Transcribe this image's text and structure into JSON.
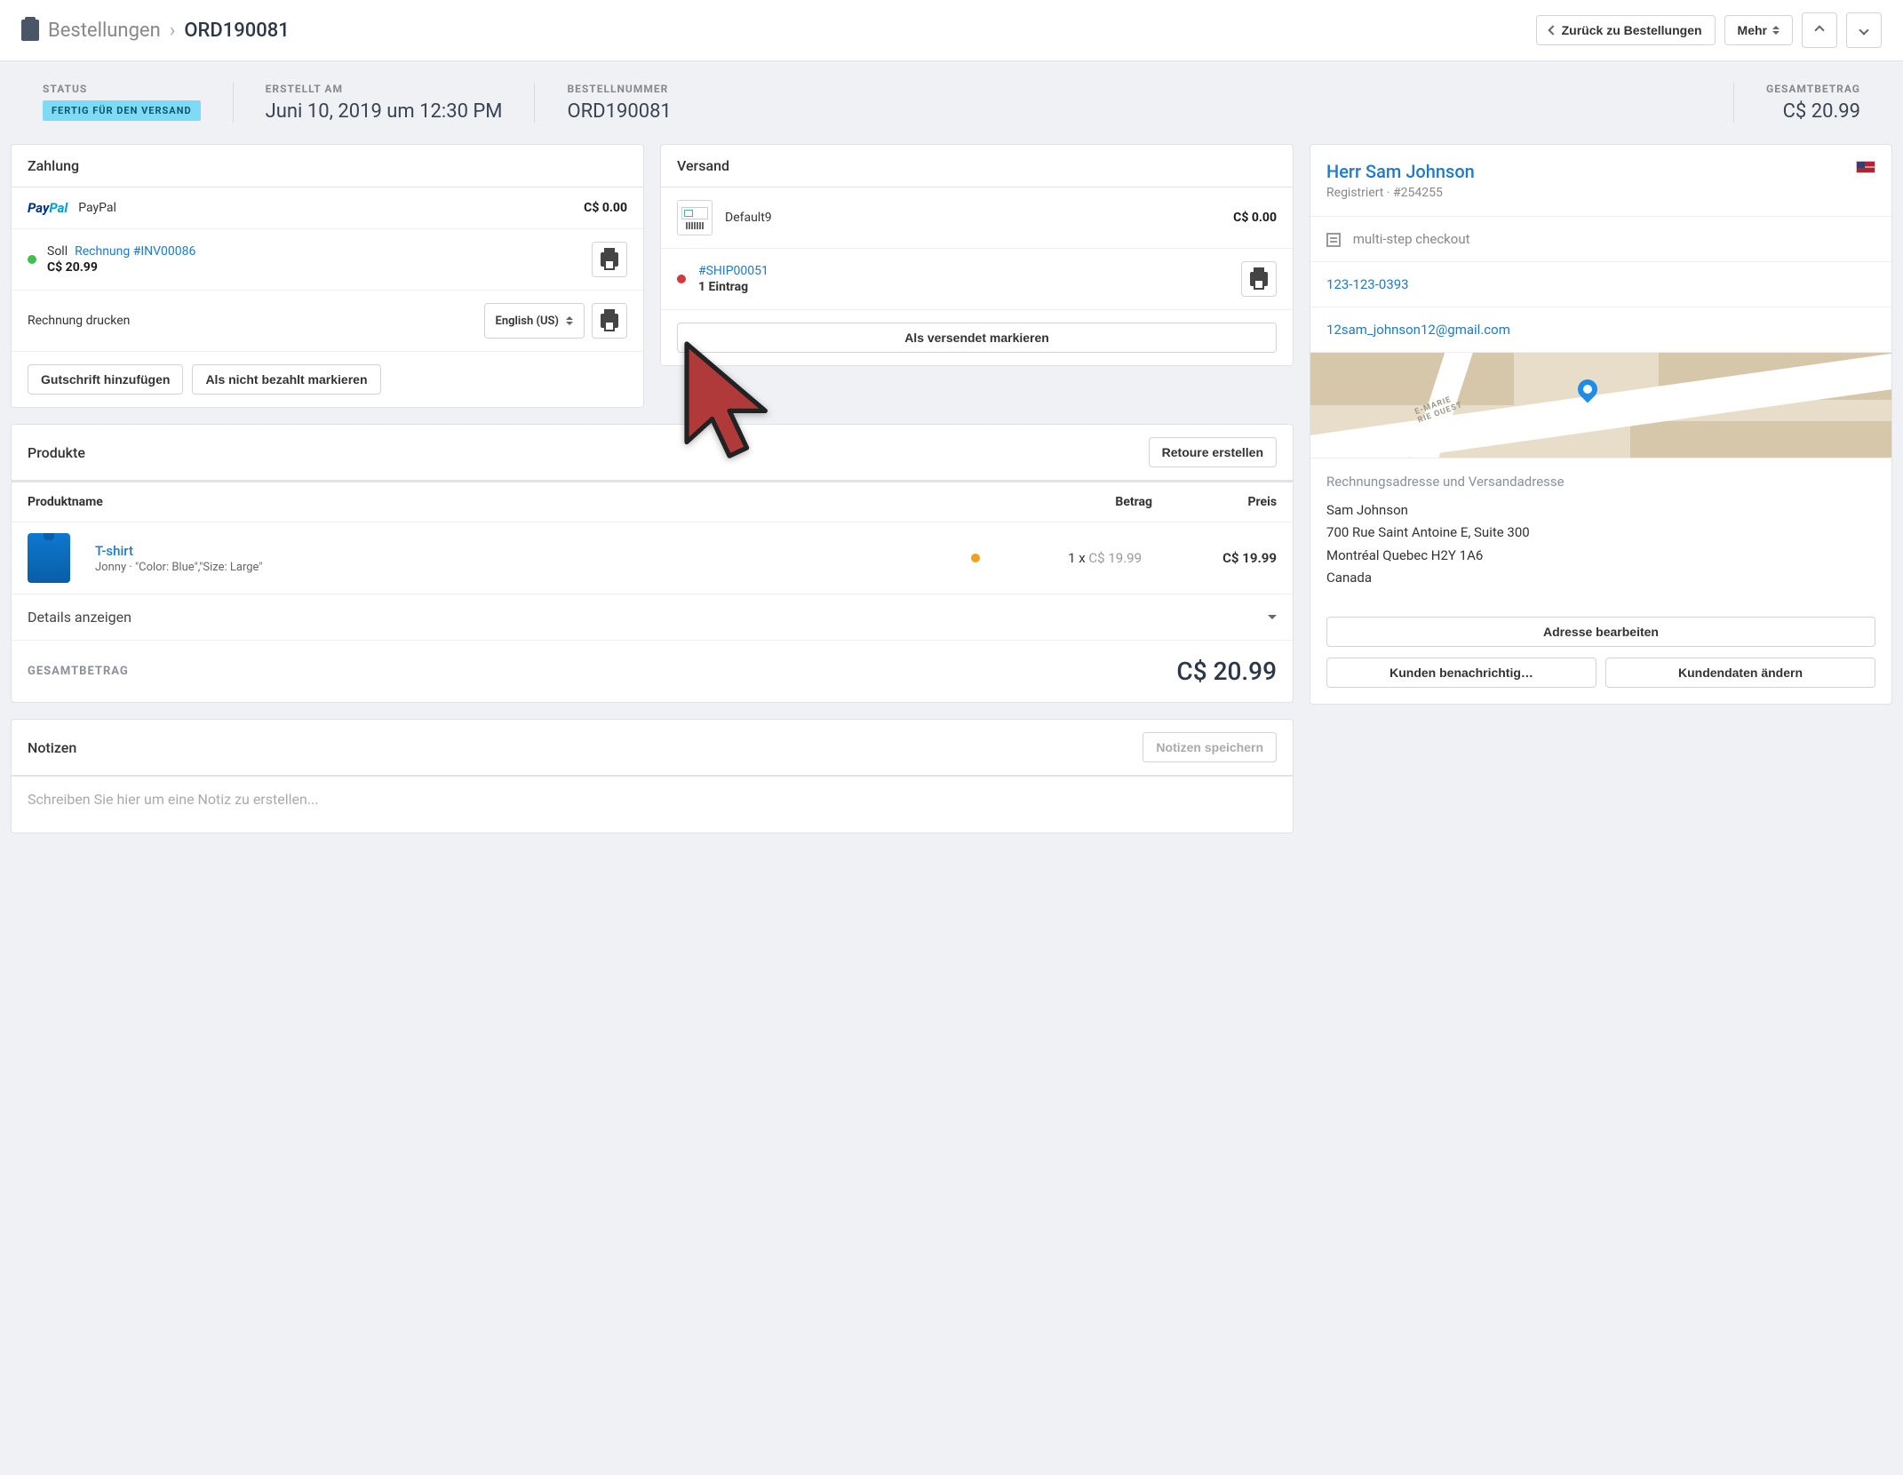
{
  "breadcrumb": {
    "parent": "Bestellungen",
    "current": "ORD190081"
  },
  "headerActions": {
    "back": "Zurück zu Bestellungen",
    "more": "Mehr"
  },
  "summary": {
    "statusLabel": "STATUS",
    "statusBadge": "FERTIG FÜR DEN VERSAND",
    "createdLabel": "ERSTELLT AM",
    "createdValue": "Juni 10, 2019 um 12:30 PM",
    "orderNumLabel": "BESTELLNUMMER",
    "orderNumValue": "ORD190081",
    "totalLabel": "GESAMTBETRAG",
    "totalValue": "C$ 20.99"
  },
  "payment": {
    "title": "Zahlung",
    "methodName": "PayPal",
    "methodAmount": "C$ 0.00",
    "stateLabel": "Soll",
    "invoiceLink": "Rechnung #INV00086",
    "invoiceAmount": "C$ 20.99",
    "printLabel": "Rechnung drucken",
    "languageSelected": "English (US)",
    "addCredit": "Gutschrift hinzufügen",
    "markUnpaid": "Als nicht bezahlt markieren"
  },
  "shipping": {
    "title": "Versand",
    "methodName": "Default9",
    "methodAmount": "C$ 0.00",
    "shipmentLink": "#SHIP00051",
    "shipmentSubtitle": "1 Eintrag",
    "markShipped": "Als versendet markieren"
  },
  "products": {
    "title": "Produkte",
    "createReturn": "Retoure erstellen",
    "colName": "Produktname",
    "colAmount": "Betrag",
    "colPrice": "Preis",
    "items": [
      {
        "name": "T-shirt",
        "sub": "Jonny · \"Color: Blue\",\"Size: Large\"",
        "qty": "1 x ",
        "unit": "C$ 19.99",
        "price": "C$ 19.99"
      }
    ],
    "detailsToggle": "Details anzeigen",
    "grandLabel": "GESAMTBETRAG",
    "grandValue": "C$ 20.99"
  },
  "notes": {
    "title": "Notizen",
    "saveBtn": "Notizen speichern",
    "placeholder": "Schreiben Sie hier um eine Notiz zu erstellen..."
  },
  "customer": {
    "name": "Herr Sam Johnson",
    "regLine": "Registriert · #254255",
    "checkout": "multi-step checkout",
    "phone": "123-123-0393",
    "email": "12sam_johnson12@gmail.com",
    "addrTitle": "Rechnungsadresse und Versandadresse",
    "addrName": "Sam Johnson",
    "addrLine1": "700 Rue Saint Antoine E, Suite 300",
    "addrLine2": "Montréal Quebec H2Y 1A6",
    "addrCountry": "Canada",
    "editAddress": "Adresse bearbeiten",
    "notifyCustomer": "Kunden benachrichtig…",
    "editCustomer": "Kundendaten ändern"
  }
}
